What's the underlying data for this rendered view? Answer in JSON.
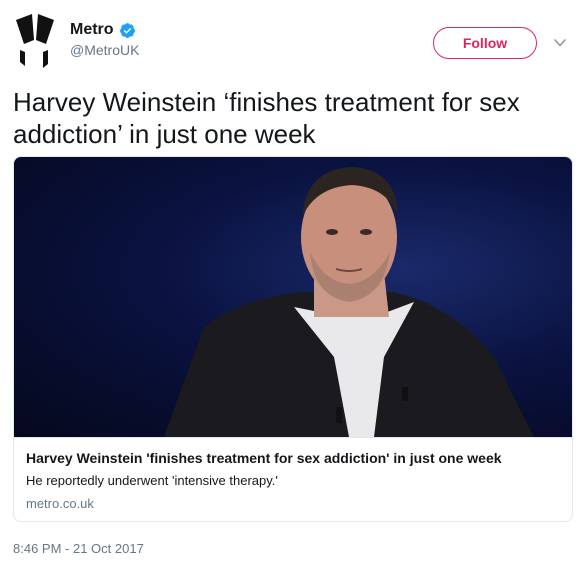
{
  "author": {
    "display_name": "Metro",
    "handle": "@MetroUK",
    "verified": true
  },
  "actions": {
    "follow_label": "Follow"
  },
  "tweet": {
    "text": "Harvey Weinstein ‘finishes treatment for sex addiction’ in just one week",
    "timestamp": "8:46 PM - 21 Oct 2017"
  },
  "card": {
    "title": "Harvey Weinstein 'finishes treatment for sex addiction' in just one week",
    "description": "He reportedly underwent 'intensive therapy.'",
    "domain": "metro.co.uk"
  },
  "icons": {
    "verified": "verified-badge-icon",
    "caret": "chevron-down-icon",
    "avatar": "metro-logo"
  },
  "colors": {
    "follow_accent": "#e0245e",
    "verified_blue": "#1da1f2",
    "secondary_text": "#657786",
    "border": "#e1e8ed"
  }
}
